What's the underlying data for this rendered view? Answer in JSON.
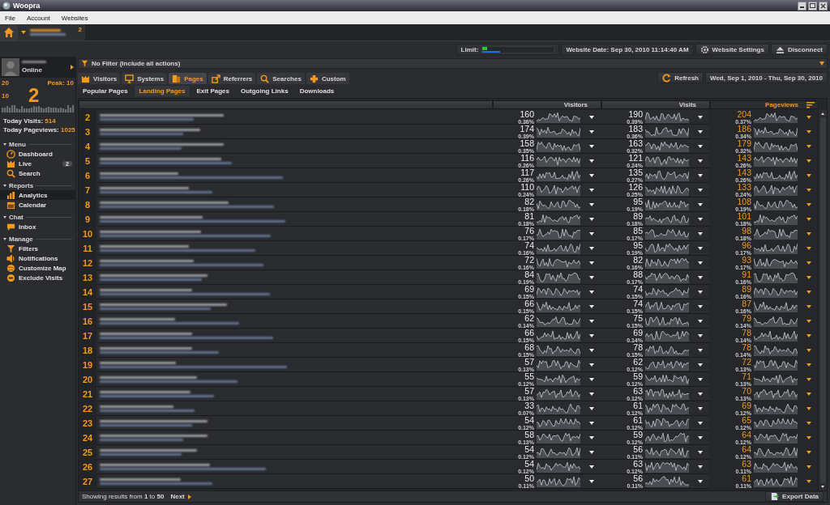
{
  "window": {
    "title": "Woopra"
  },
  "menu": [
    "File",
    "Account",
    "Websites"
  ],
  "site_tab": {
    "count": "2"
  },
  "toolbar": {
    "limit": {
      "label": "Limit:",
      "level": 0.06
    },
    "website_date": "Website Date: Sep 30, 2010 11:14:40 AM",
    "buttons": [
      {
        "label": "Website Settings",
        "kind": "settings"
      },
      {
        "label": "Disconnect",
        "kind": "eject"
      }
    ]
  },
  "sidebar": {
    "status": "Online",
    "scale_max": "20",
    "peak": "Peak: 10",
    "scale_mid": "10",
    "live_count": "2",
    "today_visits_label": "Today Visits:",
    "today_visits": "514",
    "today_pageviews_label": "Today Pageviews:",
    "today_pageviews": "1025",
    "sections": [
      {
        "title": "Menu",
        "expanded": true,
        "items": [
          {
            "label": "Dashboard",
            "kind": "dashboard",
            "selected": false
          },
          {
            "label": "Live",
            "kind": "live",
            "selected": false,
            "badge": "2"
          },
          {
            "label": "Search",
            "kind": "search",
            "selected": false
          }
        ]
      },
      {
        "title": "Reports",
        "expanded": true,
        "items": [
          {
            "label": "Analytics",
            "kind": "analytics",
            "selected": true
          },
          {
            "label": "Calendar",
            "kind": "calendar",
            "selected": false
          }
        ]
      },
      {
        "title": "Chat",
        "expanded": true,
        "items": [
          {
            "label": "Inbox",
            "kind": "inbox",
            "selected": false
          }
        ]
      },
      {
        "title": "Manage",
        "expanded": true,
        "items": [
          {
            "label": "Filters",
            "kind": "filter",
            "selected": false
          },
          {
            "label": "Notifications",
            "kind": "speaker",
            "selected": false
          },
          {
            "label": "Customize Map",
            "kind": "map",
            "selected": false
          },
          {
            "label": "Exclude Visits",
            "kind": "exclude",
            "selected": false
          }
        ]
      }
    ]
  },
  "filter": {
    "label": "No Filter (Include all actions)"
  },
  "tabs": [
    {
      "label": "Visitors",
      "kind": "visitors",
      "selected": false
    },
    {
      "label": "Systems",
      "kind": "systems",
      "selected": false
    },
    {
      "label": "Pages",
      "kind": "pages",
      "selected": true
    },
    {
      "label": "Referrers",
      "kind": "referrers",
      "selected": false
    },
    {
      "label": "Searches",
      "kind": "search",
      "selected": false
    },
    {
      "label": "Custom",
      "kind": "custom",
      "selected": false
    }
  ],
  "refresh": "Refresh",
  "date_range": "Wed, Sep 1, 2010 - Thu, Sep 30, 2010",
  "subtabs": [
    {
      "label": "Popular Pages",
      "selected": false
    },
    {
      "label": "Landing Pages",
      "selected": true
    },
    {
      "label": "Exit Pages",
      "selected": false
    },
    {
      "label": "Outgoing Links",
      "selected": false
    },
    {
      "label": "Downloads",
      "selected": false
    }
  ],
  "table": {
    "columns": [
      {
        "label": "Visitors",
        "sorted": false
      },
      {
        "label": "Visits",
        "sorted": false
      },
      {
        "label": "Pageviews",
        "sorted": true
      }
    ],
    "rows": [
      {
        "rank": "2",
        "cells": [
          {
            "value": "160",
            "share": "0.36%"
          },
          {
            "value": "190",
            "share": "0.39%"
          },
          {
            "value": "204",
            "share": "0.37%"
          }
        ]
      },
      {
        "rank": "3",
        "cells": [
          {
            "value": "174",
            "share": "0.39%"
          },
          {
            "value": "183",
            "share": "0.36%"
          },
          {
            "value": "186",
            "share": "0.34%"
          }
        ]
      },
      {
        "rank": "4",
        "cells": [
          {
            "value": "158",
            "share": "0.35%"
          },
          {
            "value": "163",
            "share": "0.32%"
          },
          {
            "value": "179",
            "share": "0.32%"
          }
        ]
      },
      {
        "rank": "5",
        "cells": [
          {
            "value": "116",
            "share": "0.26%"
          },
          {
            "value": "121",
            "share": "0.24%"
          },
          {
            "value": "143",
            "share": "0.26%"
          }
        ]
      },
      {
        "rank": "6",
        "cells": [
          {
            "value": "117",
            "share": "0.26%"
          },
          {
            "value": "135",
            "share": "0.27%"
          },
          {
            "value": "143",
            "share": "0.26%"
          }
        ]
      },
      {
        "rank": "7",
        "cells": [
          {
            "value": "110",
            "share": "0.24%"
          },
          {
            "value": "126",
            "share": "0.25%"
          },
          {
            "value": "133",
            "share": "0.24%"
          }
        ]
      },
      {
        "rank": "8",
        "cells": [
          {
            "value": "82",
            "share": "0.18%"
          },
          {
            "value": "95",
            "share": "0.19%"
          },
          {
            "value": "108",
            "share": "0.19%"
          }
        ]
      },
      {
        "rank": "9",
        "cells": [
          {
            "value": "81",
            "share": "0.18%"
          },
          {
            "value": "89",
            "share": "0.18%"
          },
          {
            "value": "101",
            "share": "0.18%"
          }
        ]
      },
      {
        "rank": "10",
        "cells": [
          {
            "value": "76",
            "share": "0.17%"
          },
          {
            "value": "85",
            "share": "0.17%"
          },
          {
            "value": "98",
            "share": "0.18%"
          }
        ]
      },
      {
        "rank": "11",
        "cells": [
          {
            "value": "74",
            "share": "0.16%"
          },
          {
            "value": "95",
            "share": "0.19%"
          },
          {
            "value": "96",
            "share": "0.17%"
          }
        ]
      },
      {
        "rank": "12",
        "cells": [
          {
            "value": "72",
            "share": "0.16%"
          },
          {
            "value": "82",
            "share": "0.16%"
          },
          {
            "value": "93",
            "share": "0.17%"
          }
        ]
      },
      {
        "rank": "13",
        "cells": [
          {
            "value": "84",
            "share": "0.19%"
          },
          {
            "value": "88",
            "share": "0.17%"
          },
          {
            "value": "91",
            "share": "0.16%"
          }
        ]
      },
      {
        "rank": "14",
        "cells": [
          {
            "value": "69",
            "share": "0.15%"
          },
          {
            "value": "74",
            "share": "0.15%"
          },
          {
            "value": "89",
            "share": "0.16%"
          }
        ]
      },
      {
        "rank": "15",
        "cells": [
          {
            "value": "66",
            "share": "0.15%"
          },
          {
            "value": "74",
            "share": "0.15%"
          },
          {
            "value": "87",
            "share": "0.16%"
          }
        ]
      },
      {
        "rank": "16",
        "cells": [
          {
            "value": "62",
            "share": "0.14%"
          },
          {
            "value": "75",
            "share": "0.15%"
          },
          {
            "value": "79",
            "share": "0.14%"
          }
        ]
      },
      {
        "rank": "17",
        "cells": [
          {
            "value": "66",
            "share": "0.15%"
          },
          {
            "value": "69",
            "share": "0.14%"
          },
          {
            "value": "78",
            "share": "0.14%"
          }
        ]
      },
      {
        "rank": "18",
        "cells": [
          {
            "value": "68",
            "share": "0.15%"
          },
          {
            "value": "78",
            "share": "0.15%"
          },
          {
            "value": "78",
            "share": "0.14%"
          }
        ]
      },
      {
        "rank": "19",
        "cells": [
          {
            "value": "57",
            "share": "0.13%"
          },
          {
            "value": "62",
            "share": "0.12%"
          },
          {
            "value": "72",
            "share": "0.13%"
          }
        ]
      },
      {
        "rank": "20",
        "cells": [
          {
            "value": "55",
            "share": "0.12%"
          },
          {
            "value": "59",
            "share": "0.12%"
          },
          {
            "value": "71",
            "share": "0.13%"
          }
        ]
      },
      {
        "rank": "21",
        "cells": [
          {
            "value": "57",
            "share": "0.13%"
          },
          {
            "value": "63",
            "share": "0.12%"
          },
          {
            "value": "70",
            "share": "0.13%"
          }
        ]
      },
      {
        "rank": "22",
        "cells": [
          {
            "value": "33",
            "share": "0.07%"
          },
          {
            "value": "61",
            "share": "0.12%"
          },
          {
            "value": "69",
            "share": "0.12%"
          }
        ]
      },
      {
        "rank": "23",
        "cells": [
          {
            "value": "54",
            "share": "0.12%"
          },
          {
            "value": "61",
            "share": "0.12%"
          },
          {
            "value": "65",
            "share": "0.12%"
          }
        ]
      },
      {
        "rank": "24",
        "cells": [
          {
            "value": "58",
            "share": "0.13%"
          },
          {
            "value": "59",
            "share": "0.12%"
          },
          {
            "value": "64",
            "share": "0.12%"
          }
        ]
      },
      {
        "rank": "25",
        "cells": [
          {
            "value": "54",
            "share": "0.12%"
          },
          {
            "value": "56",
            "share": "0.11%"
          },
          {
            "value": "64",
            "share": "0.12%"
          }
        ]
      },
      {
        "rank": "26",
        "cells": [
          {
            "value": "54",
            "share": "0.12%"
          },
          {
            "value": "63",
            "share": "0.12%"
          },
          {
            "value": "63",
            "share": "0.11%"
          }
        ]
      },
      {
        "rank": "27",
        "cells": [
          {
            "value": "50",
            "share": "0.11%"
          },
          {
            "value": "56",
            "share": "0.11%"
          },
          {
            "value": "61",
            "share": "0.11%"
          }
        ]
      }
    ]
  },
  "footer": {
    "summary": "Showing results from **1** to **50**",
    "next": "Next",
    "export": "Export Data"
  }
}
